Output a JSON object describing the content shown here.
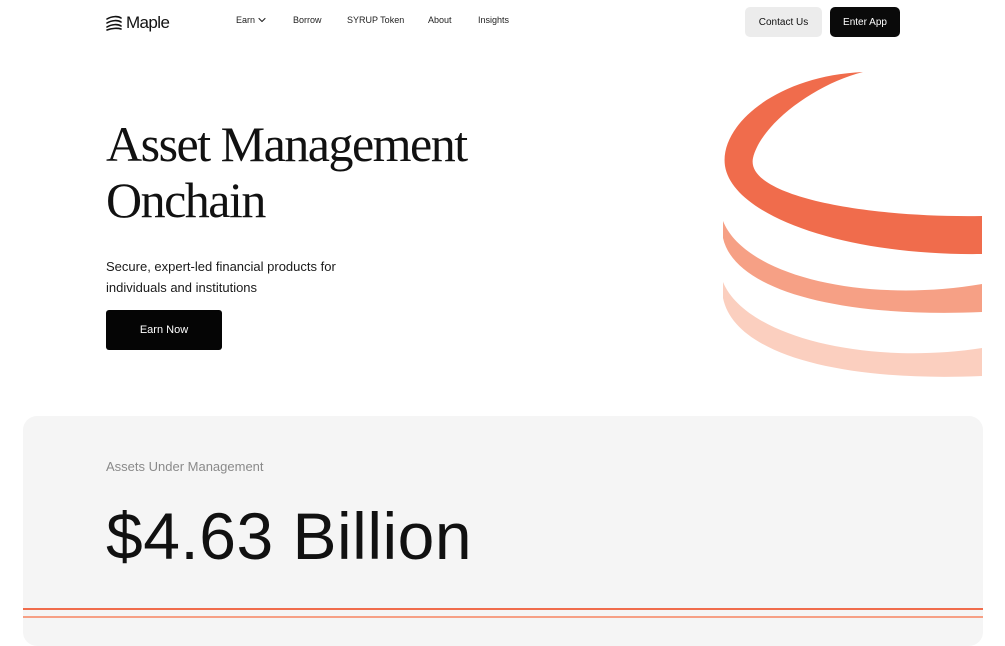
{
  "brand": {
    "name": "Maple",
    "logo_icon": "maple-logo-icon"
  },
  "nav": {
    "items": [
      {
        "label": "Earn",
        "icon": "chevron-down-icon"
      },
      {
        "label": "Borrow"
      },
      {
        "label": "SYRUP Token"
      },
      {
        "label": "About"
      },
      {
        "label": "Insights"
      }
    ]
  },
  "header_actions": {
    "contact_label": "Contact Us",
    "enter_label": "Enter App"
  },
  "hero": {
    "title_line1": "Asset Management",
    "title_line2": "Onchain",
    "subtitle_line1": "Secure, expert-led financial products for",
    "subtitle_line2": "individuals and institutions",
    "cta_label": "Earn Now",
    "art_icon": "orange-rings-illustration"
  },
  "aum": {
    "label": "Assets Under Management",
    "value": "$4.63 Billion"
  },
  "colors": {
    "accent_dark": "#f06c4c",
    "accent_mid": "#f6a085",
    "accent_light": "#fbcfbf",
    "button_dark": "#0a0a0a",
    "button_light": "#ececec",
    "panel_bg": "#f5f5f5",
    "muted_text": "#8a8a8a"
  }
}
